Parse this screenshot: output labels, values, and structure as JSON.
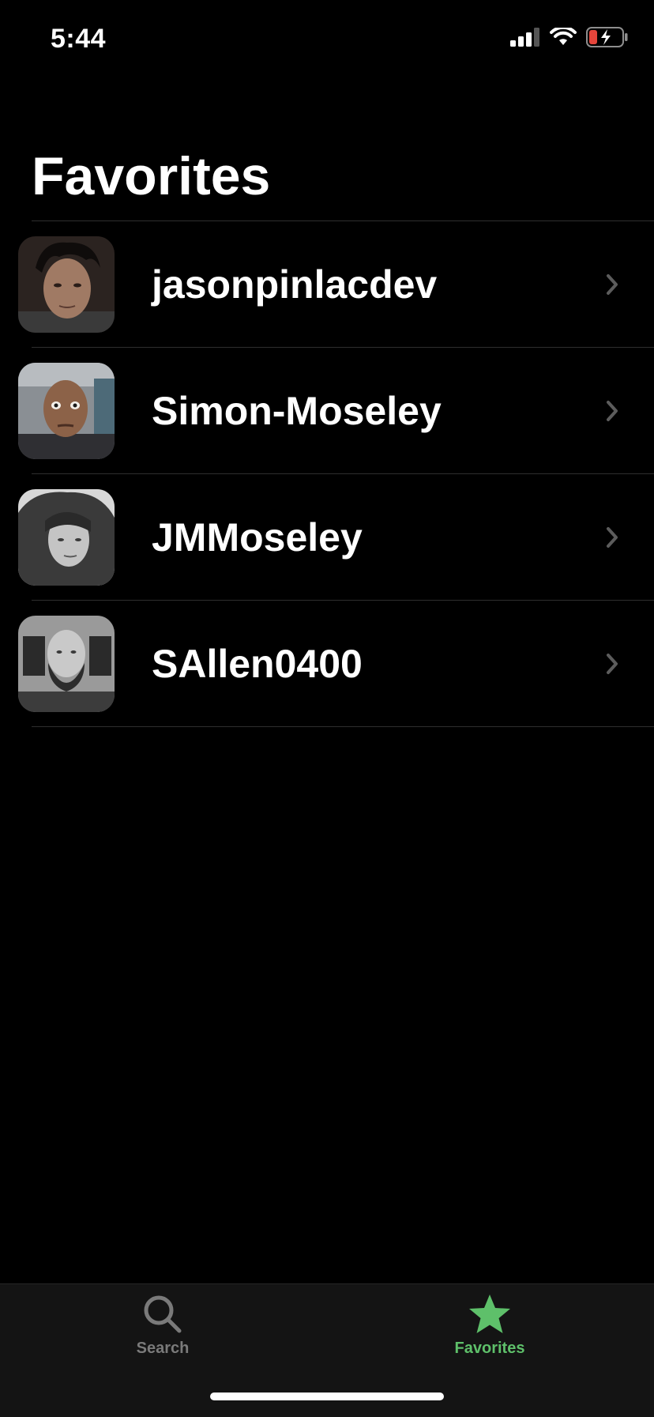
{
  "status_bar": {
    "time": "5:44",
    "icons": [
      "signal-icon",
      "wifi-icon",
      "battery-charging-icon"
    ],
    "battery_color": "#e5453b"
  },
  "header": {
    "title": "Favorites"
  },
  "favorites": [
    {
      "username": "jasonpinlacdev",
      "avatar": "avatar-photo-1"
    },
    {
      "username": "Simon-Moseley",
      "avatar": "avatar-photo-2"
    },
    {
      "username": "JMMoseley",
      "avatar": "avatar-photo-3"
    },
    {
      "username": "SAllen0400",
      "avatar": "avatar-photo-4"
    }
  ],
  "tab_bar": {
    "tabs": [
      {
        "label": "Search",
        "icon": "search-icon",
        "selected": false
      },
      {
        "label": "Favorites",
        "icon": "star-icon",
        "selected": true
      }
    ],
    "active_color": "#5ec06a",
    "inactive_color": "#7a7a7a"
  }
}
